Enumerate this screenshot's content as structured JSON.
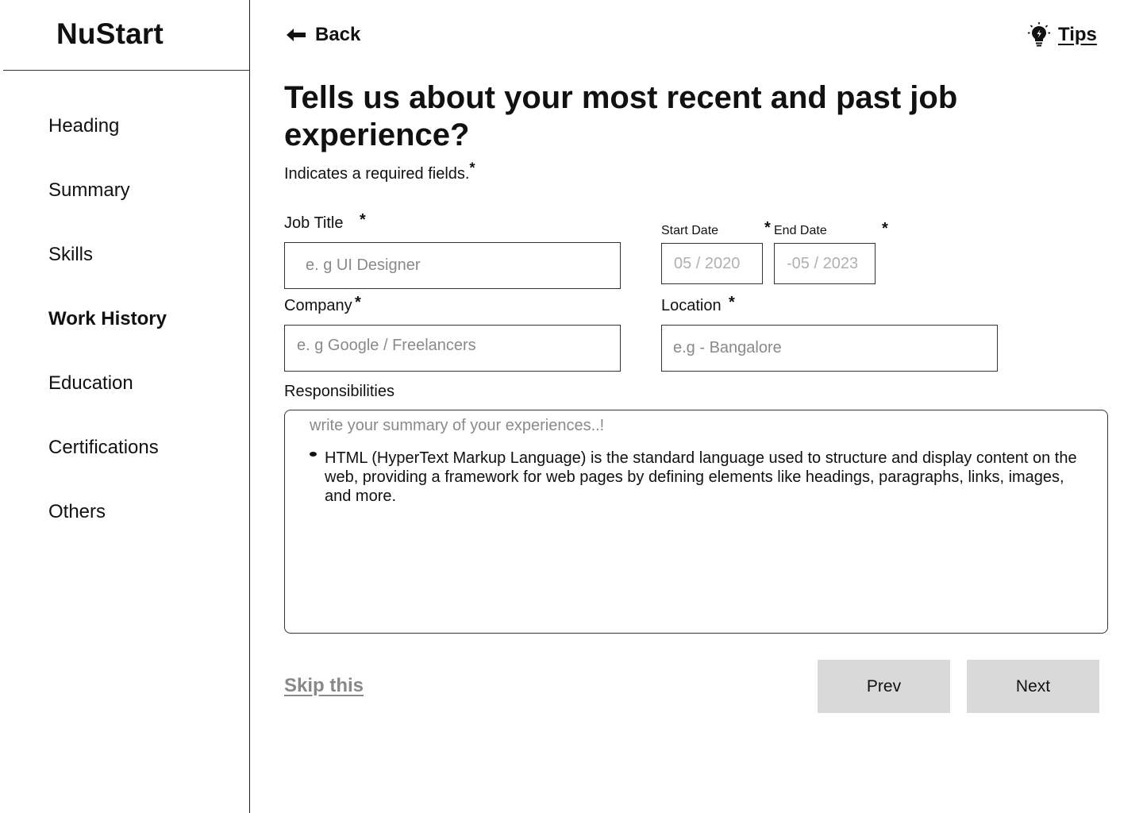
{
  "brand": {
    "name": "NuStart"
  },
  "sidebar": {
    "items": [
      {
        "label": "Heading"
      },
      {
        "label": "Summary"
      },
      {
        "label": "Skills"
      },
      {
        "label": "Work History"
      },
      {
        "label": "Education"
      },
      {
        "label": "Certifications"
      },
      {
        "label": "Others"
      }
    ]
  },
  "topbar": {
    "back_label": "Back",
    "tips_label": "Tips"
  },
  "page": {
    "title": "Tells us about your most recent and past job experience?",
    "required_note": "Indicates a required fields.",
    "required_marker": "*"
  },
  "form": {
    "job_title": {
      "label": "Job Title",
      "placeholder": "e. g UI Designer"
    },
    "start_date": {
      "label": "Start Date",
      "placeholder": "05 / 2020"
    },
    "end_date": {
      "label": "End Date",
      "placeholder": "-05 / 2023"
    },
    "company": {
      "label": "Company",
      "placeholder": "e. g Google / Freelancers"
    },
    "location": {
      "label": "Location",
      "placeholder": "e.g - Bangalore"
    },
    "responsibilities": {
      "label": "Responsibilities",
      "placeholder": "write your summary of your experiences..!",
      "bullet": "HTML (HyperText Markup Language) is the standard language used to structure and display content on the web, providing a framework for web pages by defining elements like headings, paragraphs, links, images, and more."
    }
  },
  "actions": {
    "skip_label": "Skip this",
    "prev_label": "Prev",
    "next_label": "Next"
  }
}
